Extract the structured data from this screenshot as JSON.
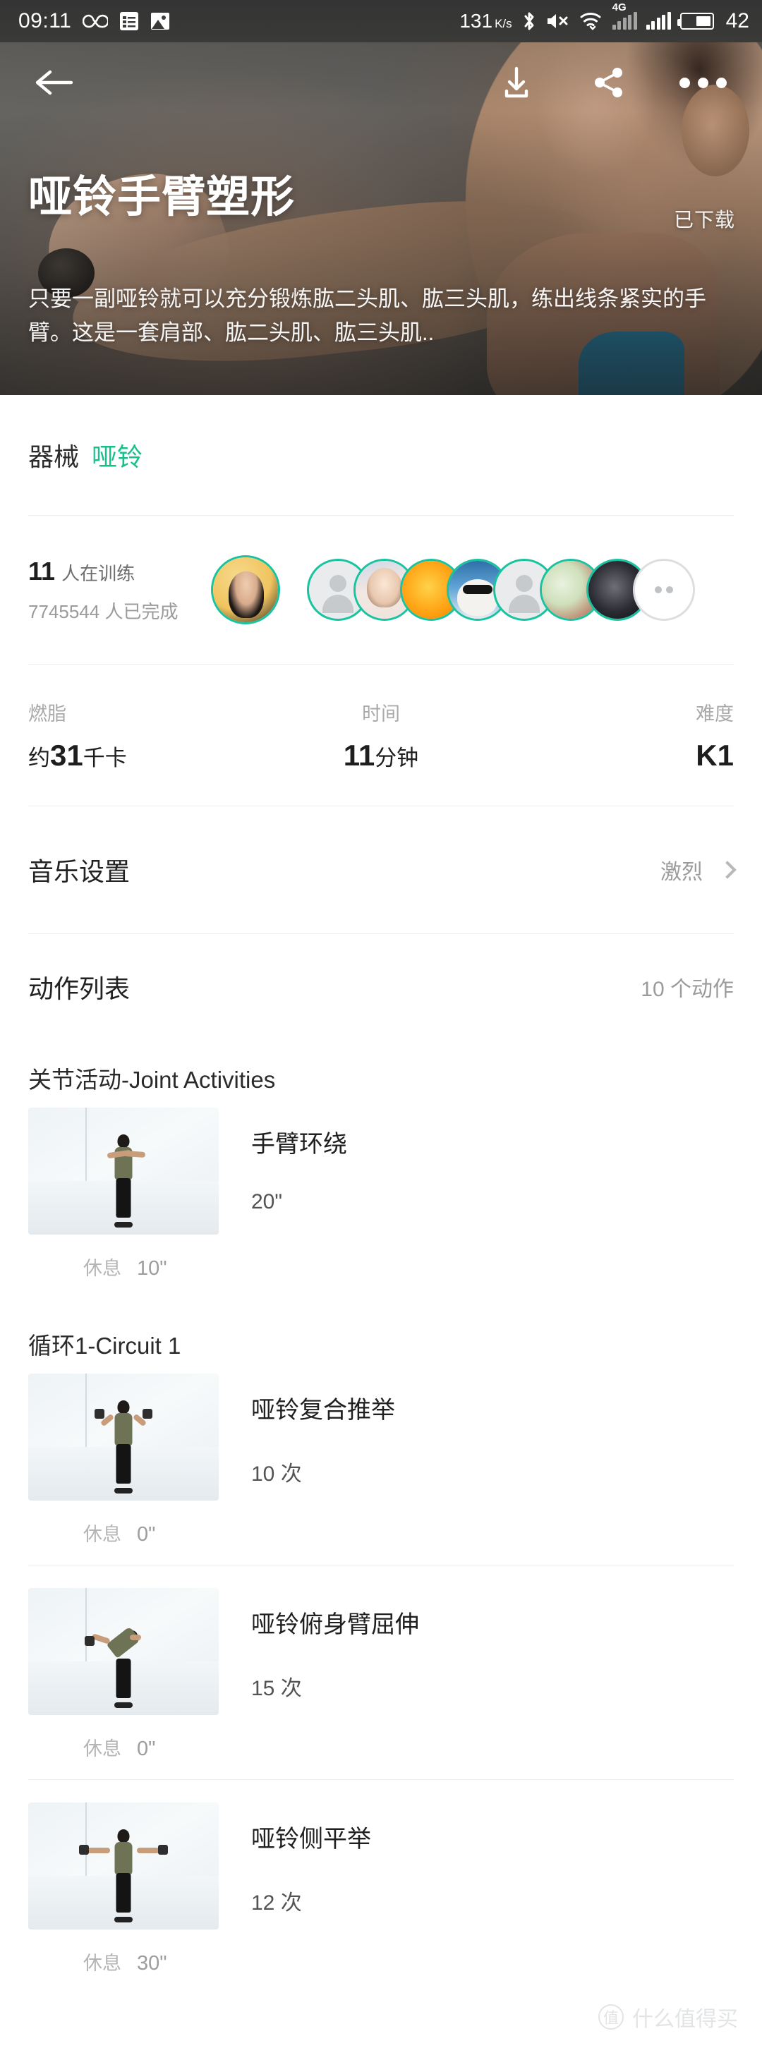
{
  "status_bar": {
    "time": "09:11",
    "icons": [
      "infinity-icon",
      "list-icon",
      "image-icon"
    ],
    "network_speed": "131",
    "network_speed_unit": "K/s",
    "right_icons": [
      "bluetooth-icon",
      "mute-icon",
      "wifi-icon",
      "4g-signal-icon",
      "signal-icon",
      "battery-icon"
    ],
    "signal_label": "4G",
    "battery_percent": "42"
  },
  "topbar": {
    "back_icon": "arrow-left-icon",
    "download_icon": "download-icon",
    "share_icon": "share-icon",
    "more_icon": "more-horizontal-icon"
  },
  "hero": {
    "title": "哑铃手臂塑形",
    "badge": "已下载",
    "description": "只要一副哑铃就可以充分锻炼肱二头肌、肱三头肌，练出线条紧实的手臂。这是一套肩部、肱二头肌、肱三头肌.."
  },
  "equipment": {
    "label": "器械",
    "value": "哑铃",
    "value_color": "#17c08a"
  },
  "trainers": {
    "training_count": "11",
    "training_suffix": "人在训练",
    "completed_text": "7745544 人已完成",
    "more_icon": "more-dots-icon"
  },
  "stats": [
    {
      "key": "燃脂",
      "prefix": "约",
      "value": "31",
      "suffix": "千卡"
    },
    {
      "key": "时间",
      "prefix": "",
      "value": "11",
      "suffix": "分钟"
    },
    {
      "key": "难度",
      "prefix": "",
      "value": "K1",
      "suffix": ""
    }
  ],
  "music": {
    "label": "音乐设置",
    "value": "激烈",
    "chevron_icon": "chevron-right-icon"
  },
  "action_list": {
    "label": "动作列表",
    "count": "10 个动作",
    "rest_label": "休息",
    "sections": [
      {
        "title": "关节活动-Joint Activities",
        "exercises": [
          {
            "name": "手臂环绕",
            "reps": "20\"",
            "rest": "10\"",
            "pose": "pose-circle"
          }
        ]
      },
      {
        "title": "循环1-Circuit 1",
        "exercises": [
          {
            "name": "哑铃复合推举",
            "reps": "10 次",
            "rest": "0\"",
            "pose": "pose-press"
          },
          {
            "name": "哑铃俯身臂屈伸",
            "reps": "15 次",
            "rest": "0\"",
            "pose": "pose-bent"
          },
          {
            "name": "哑铃侧平举",
            "reps": "12 次",
            "rest": "30\"",
            "pose": "pose-lat"
          }
        ]
      }
    ]
  },
  "watermark": {
    "mark": "值",
    "text": "什么值得买"
  }
}
